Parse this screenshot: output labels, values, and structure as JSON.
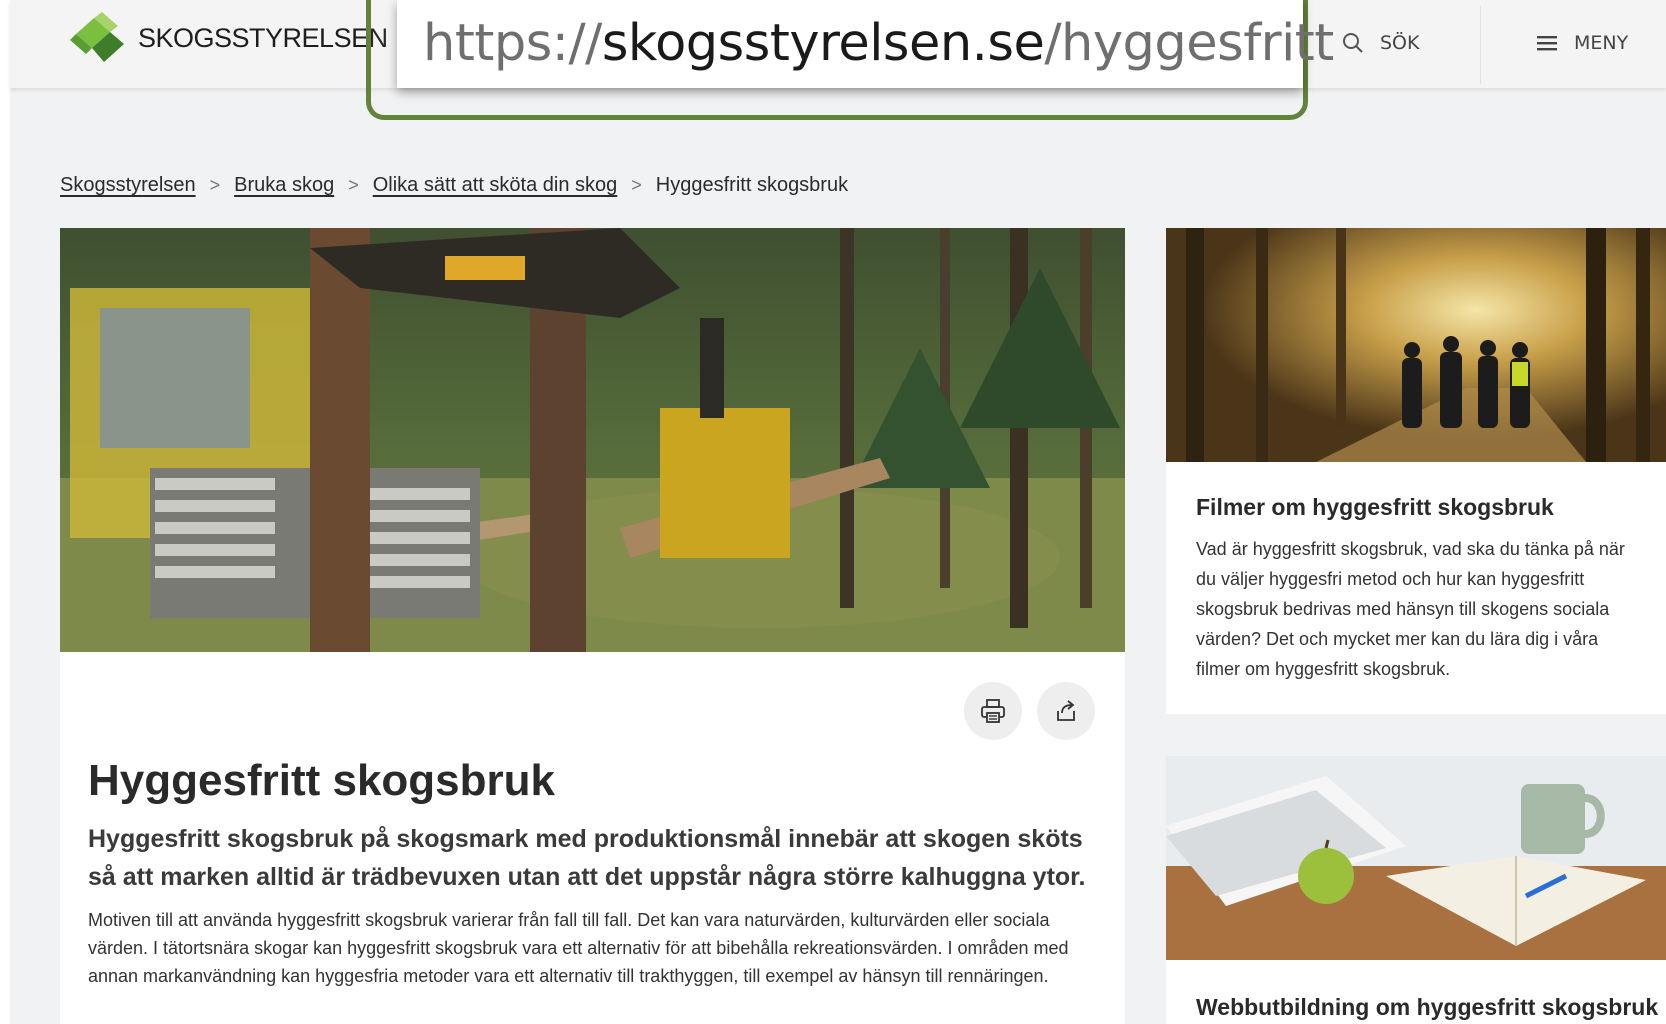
{
  "header": {
    "logo_text": "SKOGSSTYRELSEN",
    "search_label": "SÖK",
    "menu_label": "MENY"
  },
  "url_overlay": {
    "protocol": "https://",
    "host": "skogsstyrelsen.se",
    "path": "/hyggesfritt"
  },
  "breadcrumb": {
    "items": [
      "Skogsstyrelsen",
      "Bruka skog",
      "Olika sätt att sköta din skog"
    ],
    "current": "Hyggesfritt skogsbruk",
    "separator": ">"
  },
  "article": {
    "title": "Hyggesfritt skogsbruk",
    "lead": "Hyggesfritt skogsbruk på skogsmark med produktionsmål innebär att skogen sköts så att marken alltid är trädbevuxen utan att det uppstår några större kalhuggna ytor.",
    "body": "Motiven till att använda hyggesfritt skogsbruk varierar från fall till fall. Det kan vara naturvärden, kulturvärden eller sociala värden. I tätortsnära skogar kan hyggesfritt skogsbruk vara ett alternativ för att bibehålla rekreationsvärden. I områden med annan markanvändning kan hyggesfria metoder vara ett alternativ till trakthyggen, till exempel av hänsyn till rennäringen."
  },
  "cards": [
    {
      "title": "Filmer om hyggesfritt skogsbruk",
      "text": "Vad är hyggesfritt skogsbruk, vad ska du tänka på när du väljer hyggesfri metod och hur kan hyggesfritt skogsbruk bedrivas med hänsyn till skogens sociala värden? Det och mycket mer kan du lära dig i våra filmer om hyggesfritt skogsbruk."
    },
    {
      "title": "Webbutbildning om hyggesfritt skogsbruk"
    }
  ],
  "icons": {
    "logo": "leaf-diamond-logo",
    "search": "search-icon",
    "menu": "hamburger-icon",
    "print": "print-icon",
    "share": "share-icon"
  },
  "colors": {
    "brand_green": "#6aa83a",
    "overlay_border": "#63823a",
    "page_bg": "#f1f2f3"
  }
}
